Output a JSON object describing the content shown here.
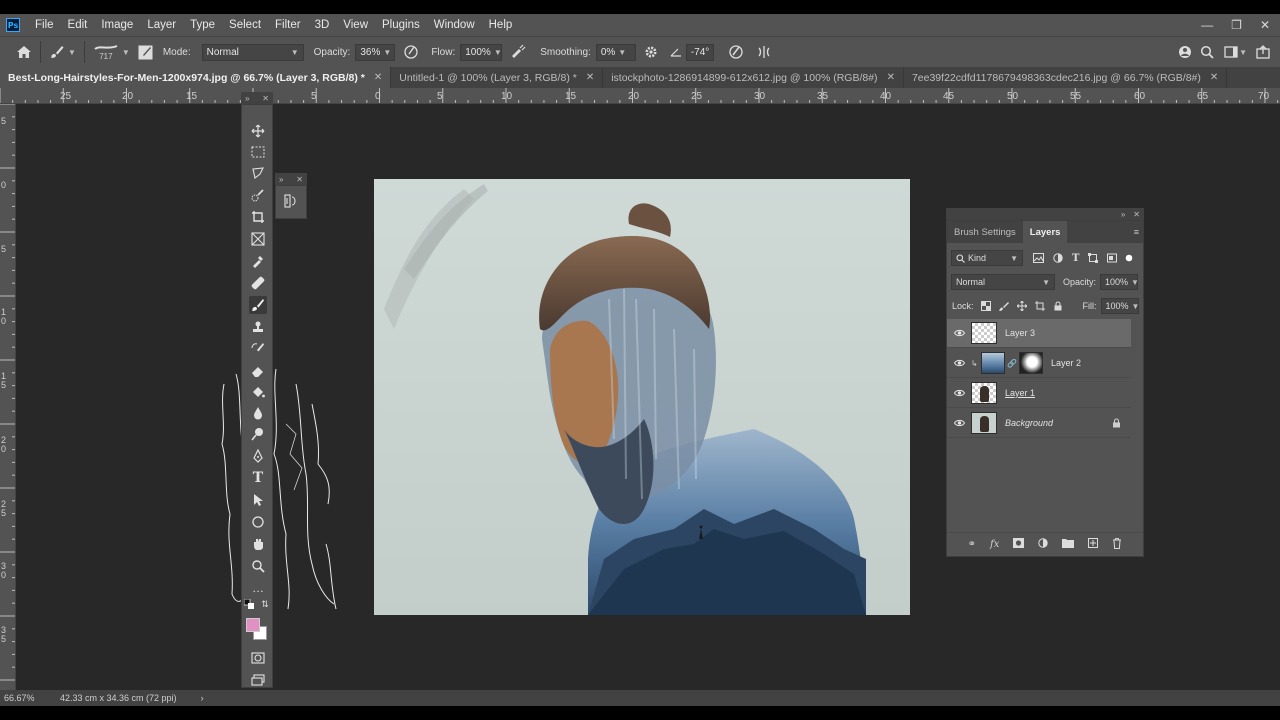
{
  "app": {
    "logo": "Ps"
  },
  "menu": [
    "File",
    "Edit",
    "Image",
    "Layer",
    "Type",
    "Select",
    "Filter",
    "3D",
    "View",
    "Plugins",
    "Window",
    "Help"
  ],
  "options": {
    "brush_size": "717",
    "mode_label": "Mode:",
    "mode_value": "Normal",
    "opacity_label": "Opacity:",
    "opacity_value": "36%",
    "flow_label": "Flow:",
    "flow_value": "100%",
    "smoothing_label": "Smoothing:",
    "smoothing_value": "0%",
    "angle_value": "-74°"
  },
  "tabs": [
    {
      "label": "Best-Long-Hairstyles-For-Men-1200x974.jpg @ 66.7% (Layer 3, RGB/8) *",
      "active": true
    },
    {
      "label": "Untitled-1 @ 100% (Layer 3, RGB/8) *",
      "active": false
    },
    {
      "label": "istockphoto-1286914899-612x612.jpg @ 100% (RGB/8#)",
      "active": false
    },
    {
      "label": "7ee39f22cdfd1178679498363cdec216.jpg @ 66.7% (RGB/8#)",
      "active": false
    }
  ],
  "ruler": {
    "h_labels": [
      "25",
      "20",
      "15",
      "10",
      "5",
      "0",
      "5",
      "10",
      "15",
      "20",
      "25",
      "30",
      "35",
      "40",
      "45",
      "50",
      "55",
      "60",
      "65",
      "70"
    ],
    "v_labels": [
      "5",
      "0",
      "5",
      "1\n0",
      "1\n5",
      "2\n0",
      "2\n5",
      "3\n0",
      "3\n5"
    ]
  },
  "layers_panel": {
    "tab_brush_settings": "Brush Settings",
    "tab_layers": "Layers",
    "filter_kind": "Kind",
    "blend_mode": "Normal",
    "opacity_label": "Opacity:",
    "opacity_value": "100%",
    "lock_label": "Lock:",
    "fill_label": "Fill:",
    "fill_value": "100%",
    "layers": [
      {
        "name": "Layer 3",
        "selected": true
      },
      {
        "name": "Layer 2",
        "selected": false
      },
      {
        "name": "Layer 1",
        "selected": false
      },
      {
        "name": "Background",
        "selected": false
      }
    ]
  },
  "status": {
    "zoom": "66.67%",
    "doc_info": "42.33 cm x 34.36 cm (72 ppi)"
  },
  "colors": {
    "foreground": "#e28fc4",
    "background": "#ffffff",
    "accent": "#31a8ff"
  }
}
